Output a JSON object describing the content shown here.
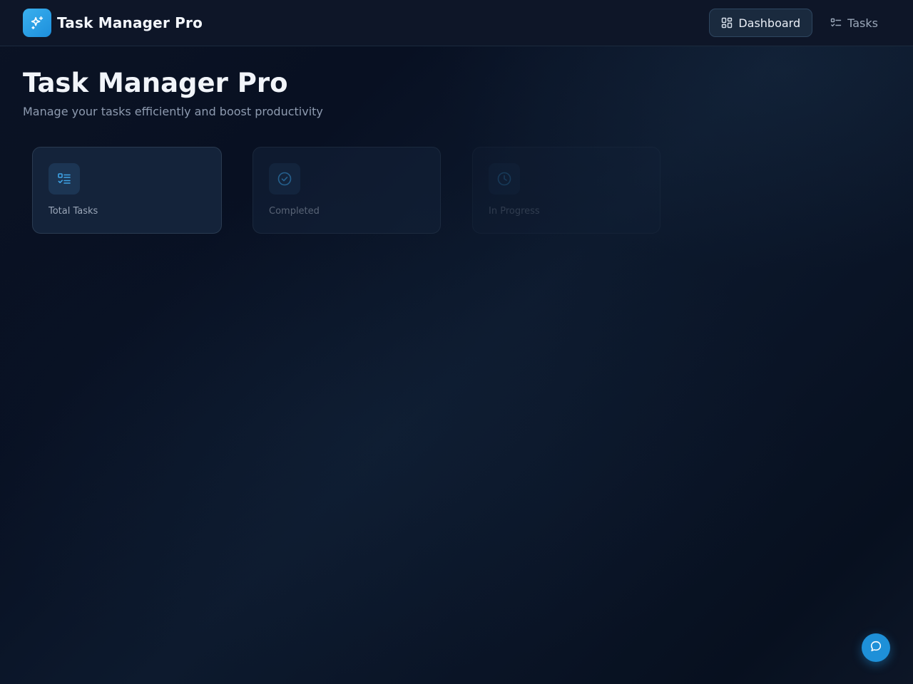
{
  "app": {
    "name": "Task Manager Pro",
    "logo_icon": "sparkles-icon",
    "accent_color": "#1e90d8"
  },
  "nav": {
    "items": [
      {
        "label": "Dashboard",
        "icon": "dashboard-grid-icon",
        "active": true
      },
      {
        "label": "Tasks",
        "icon": "list-checks-icon",
        "active": false
      }
    ]
  },
  "header": {
    "title": "Task Manager Pro",
    "subtitle": "Manage your tasks efficiently and boost productivity"
  },
  "stats": {
    "cards": [
      {
        "label": "Total Tasks",
        "icon": "list-checks-icon"
      },
      {
        "label": "Completed",
        "icon": "check-circle-icon"
      },
      {
        "label": "In Progress",
        "icon": "clock-icon"
      }
    ]
  },
  "fab": {
    "icon": "chat-bubble-icon"
  }
}
